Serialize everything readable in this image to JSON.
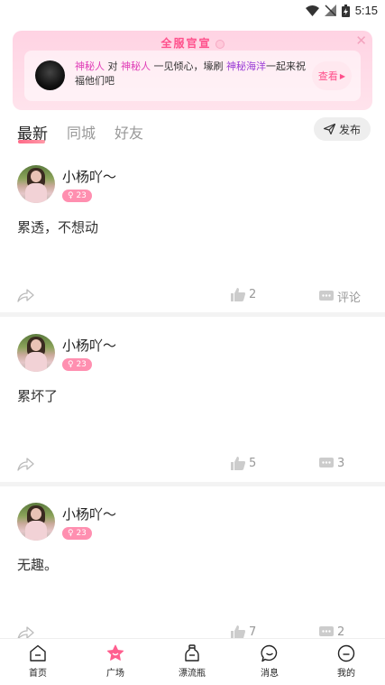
{
  "status_bar": {
    "time": "5:15"
  },
  "banner": {
    "title": "全服官宣",
    "line_parts": [
      "神秘人",
      " 对 ",
      "神秘人",
      " 一见倾心，壕刷 ",
      "神秘海洋",
      "一起来祝福他们吧"
    ],
    "button": "查看"
  },
  "tabs": {
    "items": [
      "最新",
      "同城",
      "好友"
    ],
    "active": "最新",
    "publish": "发布"
  },
  "posts": [
    {
      "author": "小杨吖～",
      "badge": "23",
      "content": "累透，不想动",
      "likes": "2",
      "comments": "评论"
    },
    {
      "author": "小杨吖～",
      "badge": "23",
      "content": "累坏了",
      "likes": "5",
      "comments": "3"
    },
    {
      "author": "小杨吖～",
      "badge": "23",
      "content": "无趣。",
      "likes": "7",
      "comments": "2"
    }
  ],
  "nav": {
    "items": [
      {
        "label": "首页",
        "icon": "home-icon"
      },
      {
        "label": "广场",
        "icon": "square-icon"
      },
      {
        "label": "漂流瓶",
        "icon": "bottle-icon"
      },
      {
        "label": "消息",
        "icon": "message-icon"
      },
      {
        "label": "我的",
        "icon": "profile-icon"
      }
    ],
    "active": "广场"
  },
  "colors": {
    "accent": "#ff4f8b",
    "badge": "#ff8fb0",
    "banner_bg": "#ffd3e3"
  }
}
